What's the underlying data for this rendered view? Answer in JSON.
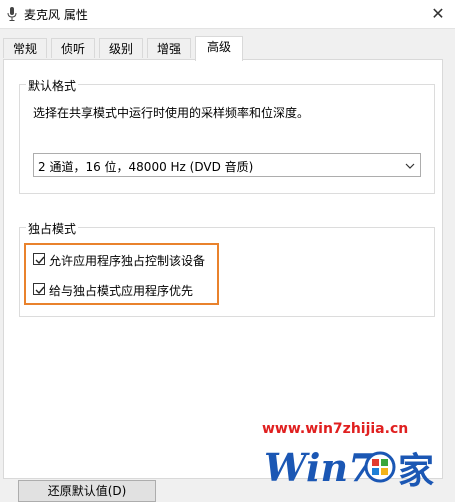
{
  "window": {
    "title": "麦克风 属性",
    "close_glyph": "✕"
  },
  "tabs": [
    {
      "label": "常规",
      "active": false
    },
    {
      "label": "侦听",
      "active": false
    },
    {
      "label": "级别",
      "active": false
    },
    {
      "label": "增强",
      "active": false
    },
    {
      "label": "高级",
      "active": true
    }
  ],
  "default_format": {
    "legend": "默认格式",
    "description": "选择在共享模式中运行时使用的采样频率和位深度。",
    "selected_value": "2 通道，16 位，48000 Hz (DVD 音质)"
  },
  "exclusive_mode": {
    "legend": "独占模式",
    "options": [
      {
        "label": "允许应用程序独占控制该设备",
        "checked": true
      },
      {
        "label": "给与独占模式应用程序优先",
        "checked": true
      }
    ]
  },
  "buttons": {
    "restore_default": "还原默认值(D)"
  },
  "watermark": {
    "url": "www.win7zhijia.cn",
    "logo_text": "Win7",
    "logo_suffix": "家"
  },
  "colors": {
    "highlight": "#e9822c",
    "watermark": "#e02020",
    "logo_blue": "#1b57b4"
  }
}
